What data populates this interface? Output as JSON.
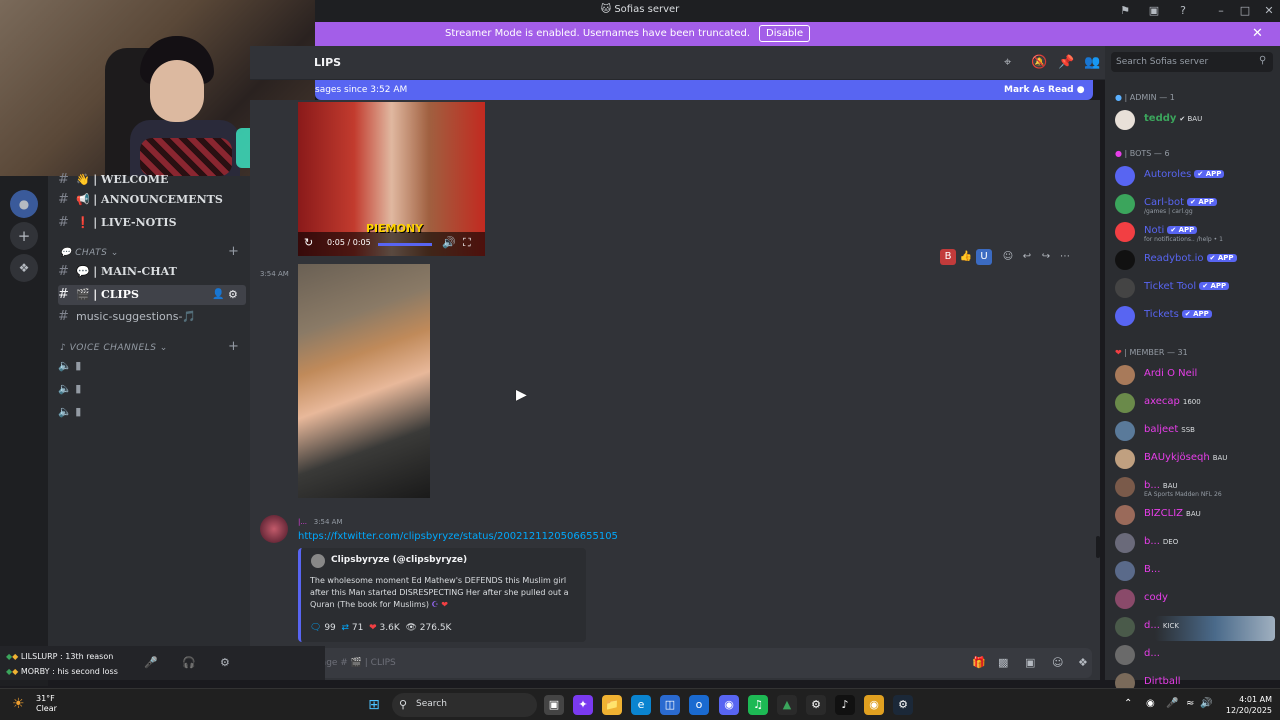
{
  "window": {
    "title": "Sofias server"
  },
  "banner": {
    "message": "Streamer Mode is enabled. Usernames have been truncated.",
    "button": "Disable"
  },
  "channels": {
    "top": [
      {
        "emoji": "👋",
        "name": "| WELCOME"
      },
      {
        "emoji": "📢",
        "name": "| ANNOUNCEMENTS"
      },
      {
        "emoji": "❗",
        "name": "| LIVE-NOTIS"
      }
    ],
    "chats_category": "CHATS",
    "chats": [
      {
        "emoji": "💬",
        "name": "| MAIN-CHAT"
      },
      {
        "emoji": "🎬",
        "name": "| CLIPS"
      },
      {
        "emoji": "",
        "name": "music-suggestions-🎵"
      }
    ],
    "voice_category": "VOICE CHANNELS"
  },
  "header": {
    "channel": "LIPS"
  },
  "newbar": {
    "left": "sages since 3:52 AM",
    "right": "Mark As Read"
  },
  "chat": {
    "video_time": "0:05 / 0:05",
    "video_logo": "PIEMONY",
    "time1": "3:54 AM",
    "msg2_author": "|...",
    "msg2_time": "3:54 AM",
    "link": "https://fxtwitter.com/clipsbyryze/status/2002121120506655105",
    "embed_author": "Clipsbyryze (@clipsbyryze)",
    "embed_text": "The wholesome moment Ed Mathew's DEFENDS this Muslim girl after this Man started DISRESPECTING Her after she pulled out a Quran (The book for Muslims)",
    "stats": {
      "replies": "99",
      "retweets": "71",
      "likes": "3.6K",
      "views": "276.5K"
    }
  },
  "input": {
    "placeholder": "Message # 🎬 | CLIPS"
  },
  "userbar": {
    "line1": "LILSLURP : 13th reason",
    "line2": "MORBY : his second loss"
  },
  "members": {
    "search_placeholder": "Search Sofias server",
    "admin_cat": "| ADMIN — 1",
    "admin": [
      {
        "name": "teddy",
        "tag": "BAU",
        "color": "#f23f43"
      }
    ],
    "bots_cat": "| BOTS — 6",
    "bots": [
      {
        "name": "Autoroles",
        "tag": "APP",
        "sub": ""
      },
      {
        "name": "Carl-bot",
        "tag": "APP",
        "sub": "/games | carl.gg"
      },
      {
        "name": "Noti",
        "tag": "APP",
        "sub": "for notifications.. /help • 1"
      },
      {
        "name": "Readybot.io",
        "tag": "APP",
        "sub": ""
      },
      {
        "name": "Ticket Tool",
        "tag": "APP",
        "sub": ""
      },
      {
        "name": "Tickets",
        "tag": "APP",
        "sub": ""
      }
    ],
    "member_cat": "| MEMBER — 31",
    "list": [
      {
        "name": "Ardi O Neil",
        "badge": "",
        "sub": ""
      },
      {
        "name": "axecap",
        "badge": "1600",
        "sub": ""
      },
      {
        "name": "baljeet",
        "badge": "SSB",
        "sub": ""
      },
      {
        "name": "BAUykjöseqh",
        "badge": "BAU",
        "sub": ""
      },
      {
        "name": "b...",
        "badge": "BAU",
        "sub": "EA Sports Madden NFL 26"
      },
      {
        "name": "BIZCLIZ",
        "badge": "BAU",
        "sub": ""
      },
      {
        "name": "b...",
        "badge": "DEO",
        "sub": ""
      },
      {
        "name": "B...",
        "badge": "",
        "sub": ""
      },
      {
        "name": "cody",
        "badge": "",
        "sub": ""
      },
      {
        "name": "d...",
        "badge": "KICK",
        "sub": ""
      },
      {
        "name": "d...",
        "badge": "",
        "sub": ""
      },
      {
        "name": "Dirtball",
        "badge": "",
        "sub": ""
      }
    ]
  },
  "taskbar": {
    "temp": "31°F",
    "condition": "Clear",
    "search": "Search",
    "time": "4:01 AM",
    "date": "12/20/2025"
  },
  "colors": {
    "accent": "#5865f2",
    "banner": "#a35ee8",
    "member": "#e63ee8",
    "bot": "#5865f2",
    "link": "#00a8fc"
  }
}
